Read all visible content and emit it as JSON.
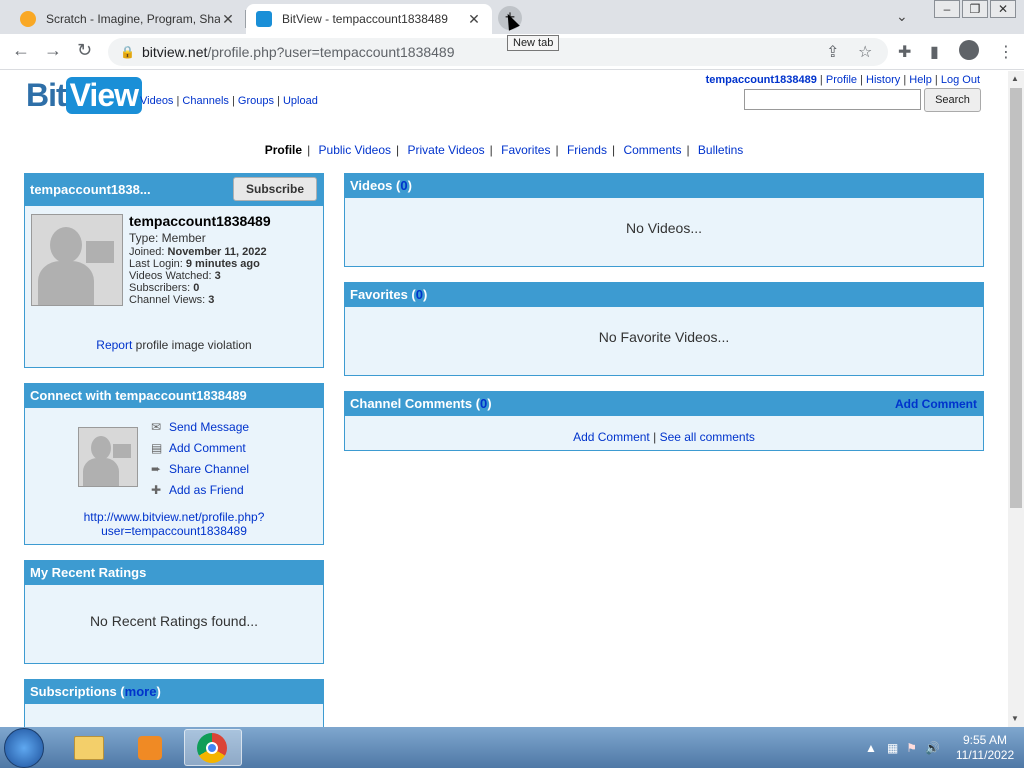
{
  "browser": {
    "tabs": [
      {
        "title": "Scratch - Imagine, Program, Shar",
        "active": false
      },
      {
        "title": "BitView - tempaccount1838489",
        "active": true
      }
    ],
    "new_tab_tooltip": "New tab",
    "url_host": "bitview.net",
    "url_path": "/profile.php?user=tempaccount1838489"
  },
  "site": {
    "logo_bit": "Bit",
    "logo_view": "View",
    "nav": [
      "Videos",
      "Channels",
      "Groups",
      "Upload"
    ],
    "user_nav": {
      "username": "tempaccount1838489",
      "links": [
        "Profile",
        "History",
        "Help",
        "Log Out"
      ]
    },
    "search_button": "Search"
  },
  "profile_nav": {
    "current": "Profile",
    "links": [
      "Public Videos",
      "Private Videos",
      "Favorites",
      "Friends",
      "Comments",
      "Bulletins"
    ]
  },
  "profile_box": {
    "header_name": "tempaccount1838...",
    "subscribe_label": "Subscribe",
    "username": "tempaccount1838489",
    "type_line": "Type: Member",
    "joined_label": "Joined: ",
    "joined_value": "November 11, 2022",
    "last_login_label": "Last Login: ",
    "last_login_value": "9 minutes ago",
    "videos_watched_label": "Videos Watched: ",
    "videos_watched_value": "3",
    "subscribers_label": "Subscribers: ",
    "subscribers_value": "0",
    "channel_views_label": "Channel Views: ",
    "channel_views_value": "3",
    "report_link": "Report",
    "report_text": " profile image violation"
  },
  "connect_box": {
    "header": "Connect with tempaccount1838489",
    "actions": [
      "Send Message",
      "Add Comment",
      "Share Channel",
      "Add as Friend"
    ],
    "url_line1": "http://www.bitview.net/profile.php?",
    "url_line2": "user=tempaccount1838489"
  },
  "ratings_box": {
    "header": "My Recent Ratings",
    "empty": "No Recent Ratings found..."
  },
  "subscriptions_box": {
    "header": "Subscriptions",
    "more_link": "more"
  },
  "videos_box": {
    "header": "Videos",
    "count": "0",
    "empty": "No Videos..."
  },
  "favorites_box": {
    "header": "Favorites",
    "count": "0",
    "empty": "No Favorite Videos..."
  },
  "comments_box": {
    "header": "Channel Comments",
    "count": "0",
    "header_action": "Add Comment",
    "link_add": "Add Comment",
    "link_all": "See all comments"
  },
  "taskbar": {
    "time": "9:55 AM",
    "date": "11/11/2022"
  }
}
